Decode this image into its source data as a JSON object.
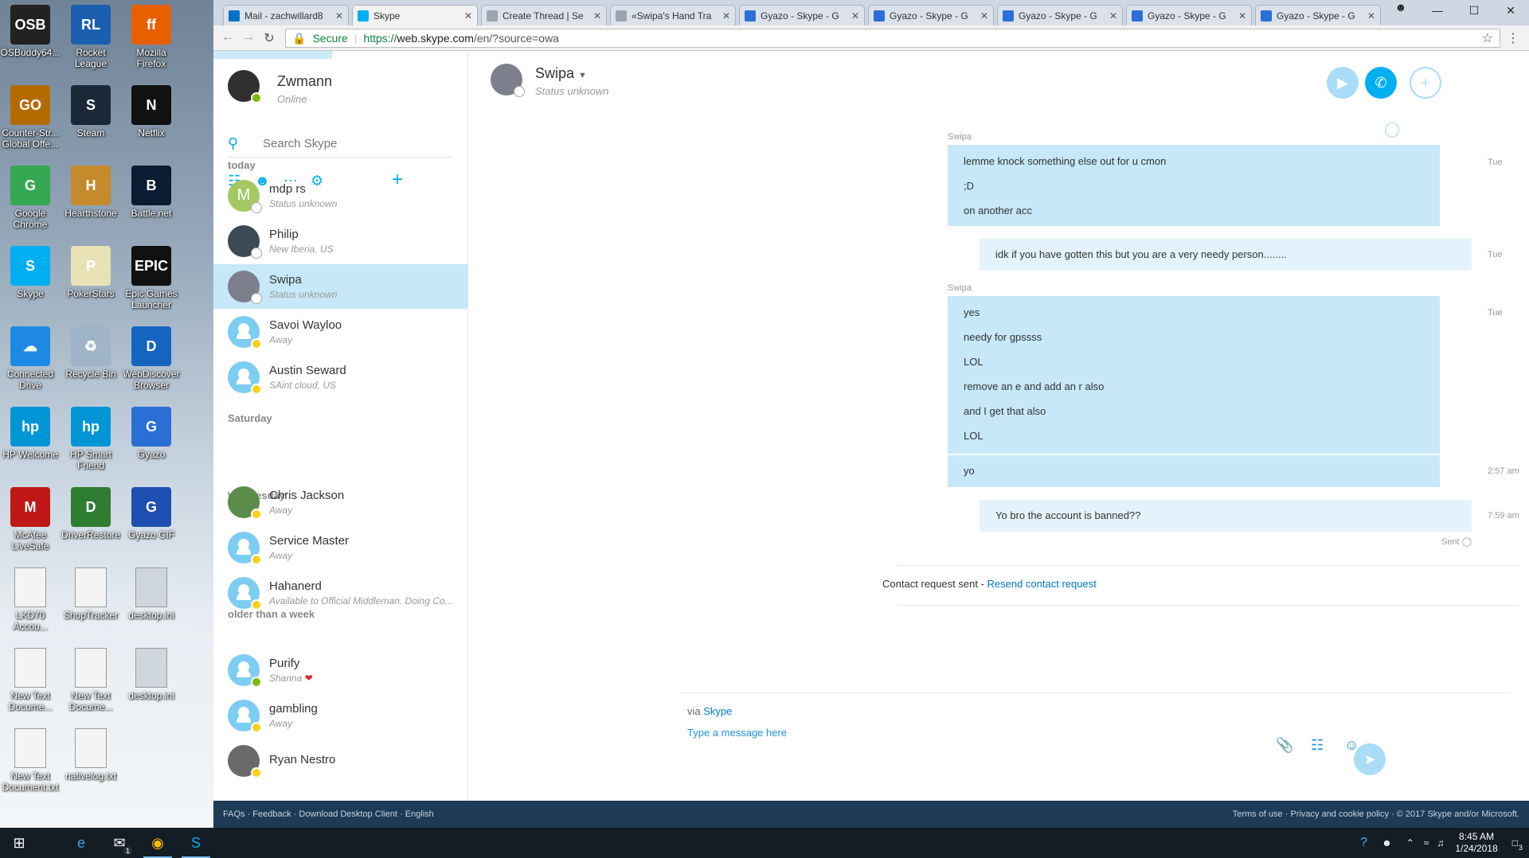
{
  "desktop": {
    "icons": [
      {
        "label": "OSBuddy64...",
        "glyph": "OSB",
        "color": "#222222"
      },
      {
        "label": "Rocket League",
        "glyph": "RL",
        "color": "#1b5fae"
      },
      {
        "label": "Mozilla Firefox",
        "glyph": "ff",
        "color": "#e66000"
      },
      {
        "label": "Counter-Str... Global Offe...",
        "glyph": "GO",
        "color": "#b36b00"
      },
      {
        "label": "Steam",
        "glyph": "S",
        "color": "#1b2838"
      },
      {
        "label": "Netflix",
        "glyph": "N",
        "color": "#111111"
      },
      {
        "label": "Google Chrome",
        "glyph": "G",
        "color": "#34a853"
      },
      {
        "label": "Hearthstone",
        "glyph": "H",
        "color": "#c58a2c"
      },
      {
        "label": "Battle.net",
        "glyph": "B",
        "color": "#0b1b33"
      },
      {
        "label": "Skype",
        "glyph": "S",
        "color": "#00aff0"
      },
      {
        "label": "PokerStars",
        "glyph": "P",
        "color": "#e9e2b6"
      },
      {
        "label": "Epic Games Launcher",
        "glyph": "EPIC",
        "color": "#111111"
      },
      {
        "label": "Connected Drive",
        "glyph": "☁",
        "color": "#1e88e5"
      },
      {
        "label": "Recycle Bin",
        "glyph": "♻",
        "color": "#9fb4c8"
      },
      {
        "label": "WebDiscover Browser",
        "glyph": "D",
        "color": "#1565c0"
      },
      {
        "label": "HP Welcome",
        "glyph": "hp",
        "color": "#0096d6"
      },
      {
        "label": "HP Smart Friend",
        "glyph": "hp",
        "color": "#0096d6"
      },
      {
        "label": "Gyazo",
        "glyph": "G",
        "color": "#2b6fd6"
      },
      {
        "label": "McAfee LiveSafe",
        "glyph": "M",
        "color": "#c01818"
      },
      {
        "label": "DriverRestore",
        "glyph": "D",
        "color": "#2e7d32"
      },
      {
        "label": "Gyazo GIF",
        "glyph": "G",
        "color": "#1e4fb0"
      },
      {
        "label": "LKD70 Accou...",
        "glyph": "",
        "color": "#f4f4f4"
      },
      {
        "label": "ShopTracker",
        "glyph": "",
        "color": "#f4f4f4"
      },
      {
        "label": "desktop.ini",
        "glyph": "",
        "color": "#cfd6dd"
      },
      {
        "label": "New Text Docume...",
        "glyph": "",
        "color": "#f4f4f4"
      },
      {
        "label": "New Text Docume...",
        "glyph": "",
        "color": "#f4f4f4"
      },
      {
        "label": "desktop.ini",
        "glyph": "",
        "color": "#cfd6dd"
      },
      {
        "label": "New Text Document.txt",
        "glyph": "",
        "color": "#f4f4f4"
      },
      {
        "label": "nativelog.txt",
        "glyph": "",
        "color": "#f4f4f4"
      }
    ]
  },
  "browser": {
    "tabs": [
      {
        "title": "Mail - zachwillard8",
        "color": "#0072c6",
        "active": false
      },
      {
        "title": "Skype",
        "color": "#00aff0",
        "active": true
      },
      {
        "title": "Create Thread | Se",
        "color": "#9aa5b1",
        "active": false
      },
      {
        "title": "«Swipa's Hand Tra",
        "color": "#9aa5b1",
        "active": false
      },
      {
        "title": "Gyazo - Skype - G",
        "color": "#2b6fd6",
        "active": false
      },
      {
        "title": "Gyazo - Skype - G",
        "color": "#2b6fd6",
        "active": false
      },
      {
        "title": "Gyazo - Skype - G",
        "color": "#2b6fd6",
        "active": false
      },
      {
        "title": "Gyazo - Skype - G",
        "color": "#2b6fd6",
        "active": false
      },
      {
        "title": "Gyazo - Skype - G",
        "color": "#2b6fd6",
        "active": false
      }
    ],
    "secure_label": "Secure",
    "url_scheme": "https://",
    "url_host": "web.skype.com",
    "url_rest": "/en/?source=owa"
  },
  "skype": {
    "me": {
      "name": "Zwmann",
      "status": "Online"
    },
    "search_placeholder": "Search Skype",
    "groups": [
      {
        "label": "today"
      },
      {
        "label": "Saturday"
      },
      {
        "label": "Wednesday"
      },
      {
        "label": "older than a week"
      }
    ],
    "contacts": [
      {
        "name": "mdp rs",
        "status": "Status unknown",
        "avatar": "M",
        "avcolor": "#a4c963",
        "pres": "unknown"
      },
      {
        "name": "Philip",
        "status": "New Iberia, US",
        "avatar": "",
        "avcolor": "#3d4a55",
        "pres": "unknown"
      },
      {
        "name": "Swipa",
        "status": "Status unknown",
        "avatar": "",
        "avcolor": "#7e7f8c",
        "pres": "unknown",
        "selected": true
      },
      {
        "name": "Savoi Wayloo",
        "status": "Away",
        "avatar": "default",
        "avcolor": "#7ccdf1",
        "pres": "away"
      },
      {
        "name": "Austin Seward",
        "status": "SAint cloud, US",
        "avatar": "default",
        "avcolor": "#7ccdf1",
        "pres": "away"
      },
      {
        "name": "Chris Jackson",
        "status": "Away",
        "avatar": "",
        "avcolor": "#5b8c4a",
        "pres": "away"
      },
      {
        "name": "Service Master",
        "status": "Away",
        "avatar": "default",
        "avcolor": "#7ccdf1",
        "pres": "away"
      },
      {
        "name": "Hahanerd",
        "status": "Available to Official Middleman. Doing Co...",
        "avatar": "default",
        "avcolor": "#7ccdf1",
        "pres": "away"
      },
      {
        "name": "Purify",
        "status": "Shanna",
        "avatar": "default",
        "avcolor": "#7ccdf1",
        "pres": "online",
        "heart": "❤"
      },
      {
        "name": "gambling",
        "status": "Away",
        "avatar": "default",
        "avcolor": "#7ccdf1",
        "pres": "away"
      },
      {
        "name": "Ryan Nestro",
        "status": "",
        "avatar": "",
        "avcolor": "#6a6a6a",
        "pres": "away"
      }
    ],
    "conversation": {
      "name": "Swipa",
      "status": "Status unknown",
      "sender1": "Swipa",
      "msg1": [
        "lemme knock something else out for u cmon",
        ";D",
        "on another acc"
      ],
      "ts1": "Tue",
      "msg2": "idk if you have gotten this but you are a very needy person........",
      "ts2": "Tue",
      "sender2": "Swipa",
      "msg3": [
        "yes",
        "needy for gpssss",
        "LOL",
        "remove an e and add an r also",
        "and I get that also",
        "LOL"
      ],
      "ts3": "Tue",
      "msg4": "yo",
      "ts4": "2:57 am",
      "msg5": "Yo bro the account is banned??",
      "ts5": "7:59 am",
      "sent": "Sent",
      "request_text": "Contact request sent - ",
      "request_link": "Resend contact request",
      "via": "via ",
      "via_link": "Skype",
      "compose_placeholder": "Type a message here"
    },
    "footer": {
      "left": [
        "FAQs",
        "Feedback",
        "Download Desktop Client",
        "English"
      ],
      "right": [
        "Terms of use",
        "Privacy and cookie policy",
        "© 2017 Skype and/or Microsoft."
      ]
    }
  },
  "taskbar": {
    "time": "8:45 AM",
    "date": "1/24/2018",
    "notif_count": "3",
    "mail_badge": "1"
  }
}
